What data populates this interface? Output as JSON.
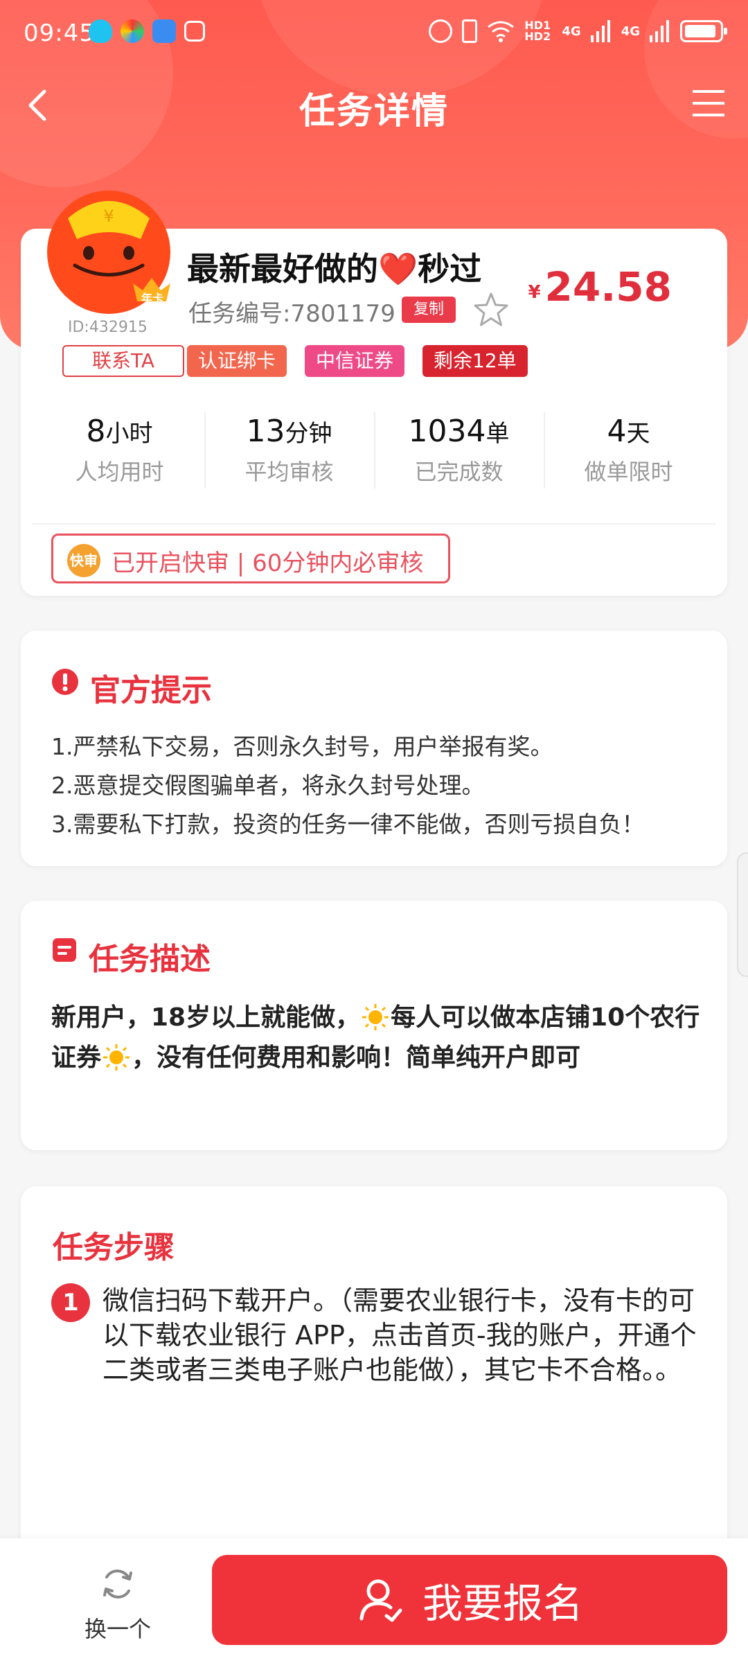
{
  "status_bar": {
    "time": "09:45",
    "hd_label": "HD1 HD2",
    "net1": "4G",
    "net2": "4G"
  },
  "nav": {
    "title": "任务详情",
    "back_icon": "chevron-left-icon",
    "menu_icon": "hamburger-menu-icon"
  },
  "task": {
    "title": "最新最好做的❤️秒过",
    "task_no": "任务编号:7801179",
    "copy_label": "复制",
    "price_symbol": "¥",
    "price": "24.58",
    "user_id": "ID:432915",
    "badge_label": "年卡",
    "contact_label": "联系TA",
    "tags": [
      "认证绑卡",
      "中信证券",
      "剩余12单"
    ],
    "stats": [
      {
        "value": "8",
        "unit": "小时",
        "label": "人均用时"
      },
      {
        "value": "13",
        "unit": "分钟",
        "label": "平均审核"
      },
      {
        "value": "1034",
        "unit": "单",
        "label": "已完成数"
      },
      {
        "value": "4",
        "unit": "天",
        "label": "做单限时"
      }
    ],
    "fast_icon_label": "快审",
    "fast_text": "已开启快审 | 60分钟内必审核"
  },
  "tips": {
    "title": "官方提示",
    "items": [
      "1.严禁私下交易，否则永久封号，用户举报有奖。",
      "2.恶意提交假图骗单者，将永久封号处理。",
      "3.需要私下打款，投资的任务一律不能做，否则亏损自负！"
    ]
  },
  "description": {
    "title": "任务描述",
    "part1": "新用户，18岁以上就能做，",
    "part2": "每人可以做本店铺10个农行证券",
    "part3": "，没有任何费用和影响！简单纯开户即可"
  },
  "steps": {
    "title": "任务步骤",
    "items": [
      {
        "num": "1",
        "text": "微信扫码下载开户。（需要农业银行卡，没有卡的可以下载农业银行 APP，点击首页-我的账户，开通个二类或者三类电子账户也能做），其它卡不合格。。"
      }
    ]
  },
  "bottom": {
    "swap_label": "换一个",
    "signup_label": "我要报名"
  },
  "colors": {
    "primary": "#f0323a",
    "header": "#ff5a4f",
    "price": "#e02e3c"
  }
}
